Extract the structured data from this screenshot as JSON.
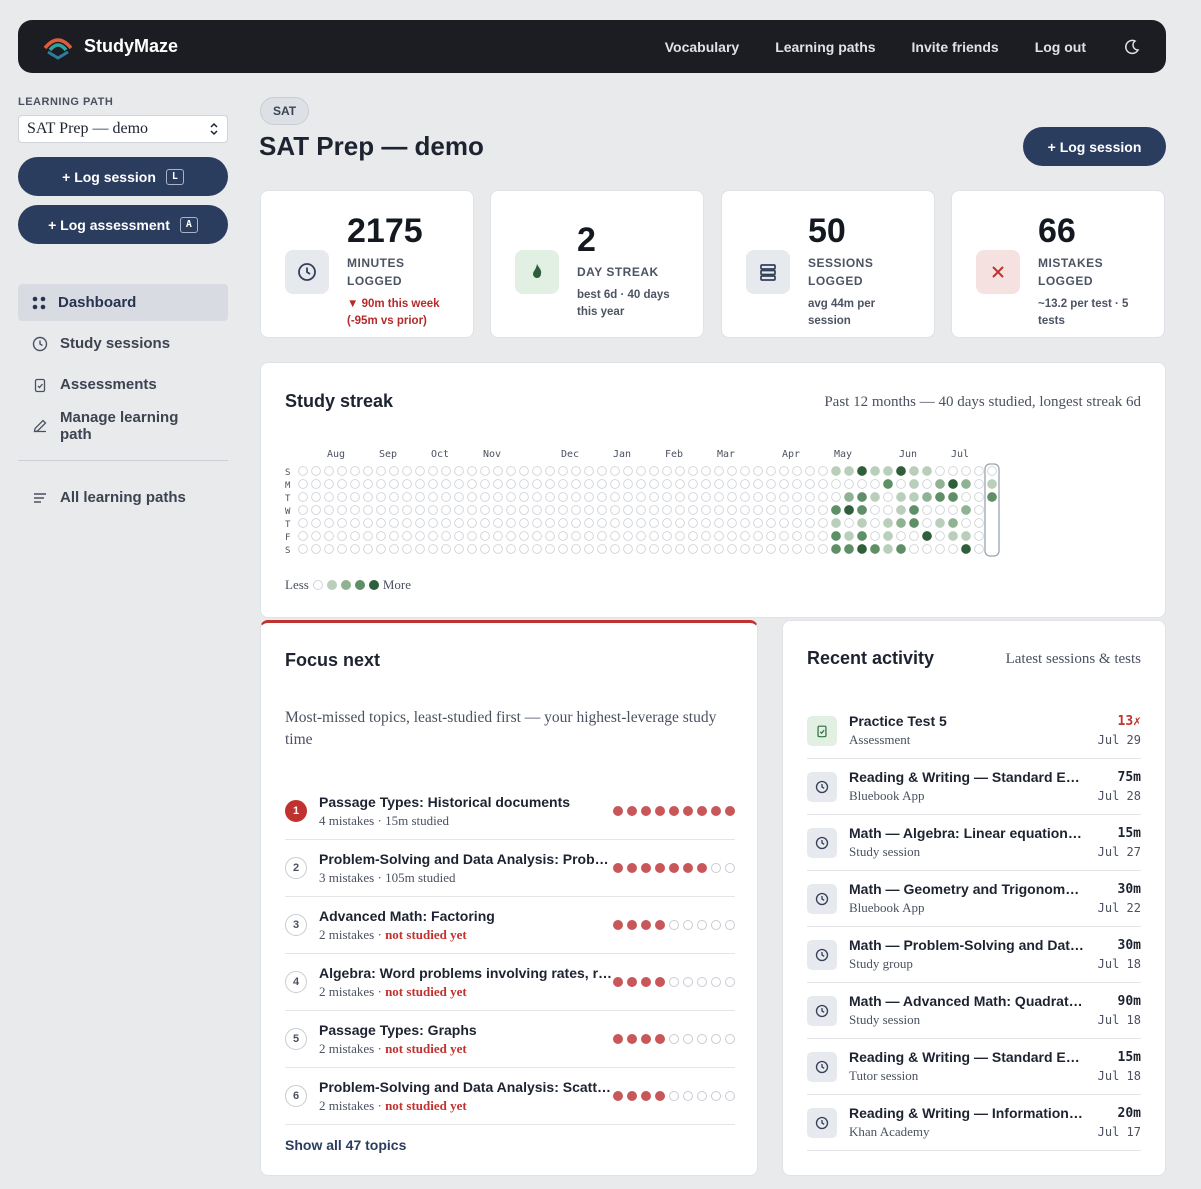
{
  "brand": {
    "name": "StudyMaze"
  },
  "nav": {
    "links": [
      "Vocabulary",
      "Learning paths",
      "Invite friends",
      "Log out"
    ],
    "theme_icon": "moon-icon"
  },
  "sidebar": {
    "path_label": "LEARNING PATH",
    "path_value": "SAT Prep — demo",
    "log_session": "+ Log session",
    "log_session_key": "L",
    "log_assessment": "+ Log assessment",
    "log_assessment_key": "A",
    "items": [
      {
        "label": "Dashboard",
        "icon": "grid-icon",
        "active": true
      },
      {
        "label": "Study sessions",
        "icon": "clock-icon"
      },
      {
        "label": "Assessments",
        "icon": "clipboard-check-icon"
      },
      {
        "label": "Manage learning path",
        "icon": "pencil-icon"
      }
    ],
    "all_paths": "All learning paths"
  },
  "header": {
    "tag": "SAT",
    "title": "SAT Prep — demo",
    "button": "+ Log session"
  },
  "stats": [
    {
      "value": "2175",
      "label1": "MINUTES",
      "label2": "LOGGED",
      "sub1": "▼ 90m this week",
      "sub2": "(-95m vs prior)",
      "accent": "#b52a2a",
      "icon": "clock-icon"
    },
    {
      "value": "2",
      "label1": "DAY STREAK",
      "label2": "",
      "sub1": "best 6d · 40 days",
      "sub2": "this year",
      "icon": "flame-icon"
    },
    {
      "value": "50",
      "label1": "SESSIONS",
      "label2": "LOGGED",
      "sub1": "avg 44m per",
      "sub2": "session",
      "icon": "stack-icon"
    },
    {
      "value": "66",
      "label1": "MISTAKES",
      "label2": "LOGGED",
      "sub1": "~13.2 per test · 5",
      "sub2": "tests",
      "icon": "x-icon"
    }
  ],
  "streak": {
    "title": "Study streak",
    "meta": "Past 12 months — 40 days studied, longest streak 6d",
    "months": [
      "Aug",
      "Sep",
      "Oct",
      "Nov",
      "Dec",
      "Jan",
      "Feb",
      "Mar",
      "Apr",
      "May",
      "Jun",
      "Jul"
    ],
    "days": [
      "S",
      "M",
      "T",
      "W",
      "T",
      "F",
      "S"
    ],
    "legend_less": "Less",
    "legend_more": "More",
    "colors": [
      "#ffffff",
      "#b9cfbb",
      "#8fb293",
      "#5e8f66",
      "#2f5e3a"
    ]
  },
  "focus": {
    "title": "Focus next",
    "intro": "Most-missed topics, least-studied first — your highest-leverage study time",
    "topics": [
      {
        "rank": "1",
        "name": "Passage Types: Historical documents",
        "mistakes": "4 mistakes · ",
        "studied": "15m studied",
        "not_studied": false,
        "level": 9
      },
      {
        "rank": "2",
        "name": "Problem-Solving and Data Analysis: Probability",
        "mistakes": "3 mistakes · ",
        "studied": "105m studied",
        "not_studied": false,
        "level": 7
      },
      {
        "rank": "3",
        "name": "Advanced Math: Factoring",
        "mistakes": "2 mistakes · ",
        "studied": "not studied yet",
        "not_studied": true,
        "level": 4
      },
      {
        "rank": "4",
        "name": "Algebra: Word problems involving rates, ratios",
        "mistakes": "2 mistakes · ",
        "studied": "not studied yet",
        "not_studied": true,
        "level": 4
      },
      {
        "rank": "5",
        "name": "Passage Types: Graphs",
        "mistakes": "2 mistakes · ",
        "studied": "not studied yet",
        "not_studied": true,
        "level": 4
      },
      {
        "rank": "6",
        "name": "Problem-Solving and Data Analysis: Scatterplots",
        "mistakes": "2 mistakes · ",
        "studied": "not studied yet",
        "not_studied": true,
        "level": 4
      }
    ],
    "show_all": "Show all 47 topics"
  },
  "recent": {
    "title": "Recent activity",
    "meta": "Latest sessions & tests",
    "items": [
      {
        "name": "Practice Test 5",
        "sub": "Assessment",
        "value": "13✗",
        "date": "Jul 29",
        "type": "assessment"
      },
      {
        "name": "Reading & Writing — Standard English Conventions",
        "sub": "Bluebook App",
        "value": "75m",
        "date": "Jul 28",
        "type": "session"
      },
      {
        "name": "Math — Algebra: Linear equations in one variable",
        "sub": "Study session",
        "value": "15m",
        "date": "Jul 27",
        "type": "session"
      },
      {
        "name": "Math — Geometry and Trigonometry",
        "sub": "Bluebook App",
        "value": "30m",
        "date": "Jul 22",
        "type": "session"
      },
      {
        "name": "Math — Problem-Solving and Data Analysis",
        "sub": "Study group",
        "value": "30m",
        "date": "Jul 18",
        "type": "session"
      },
      {
        "name": "Math — Advanced Math: Quadratics",
        "sub": "Study session",
        "value": "90m",
        "date": "Jul 18",
        "type": "session"
      },
      {
        "name": "Reading & Writing — Standard English Conventions",
        "sub": "Tutor session",
        "value": "15m",
        "date": "Jul 18",
        "type": "session"
      },
      {
        "name": "Reading & Writing — Information and Ideas",
        "sub": "Khan Academy",
        "value": "20m",
        "date": "Jul 17",
        "type": "session"
      }
    ]
  }
}
